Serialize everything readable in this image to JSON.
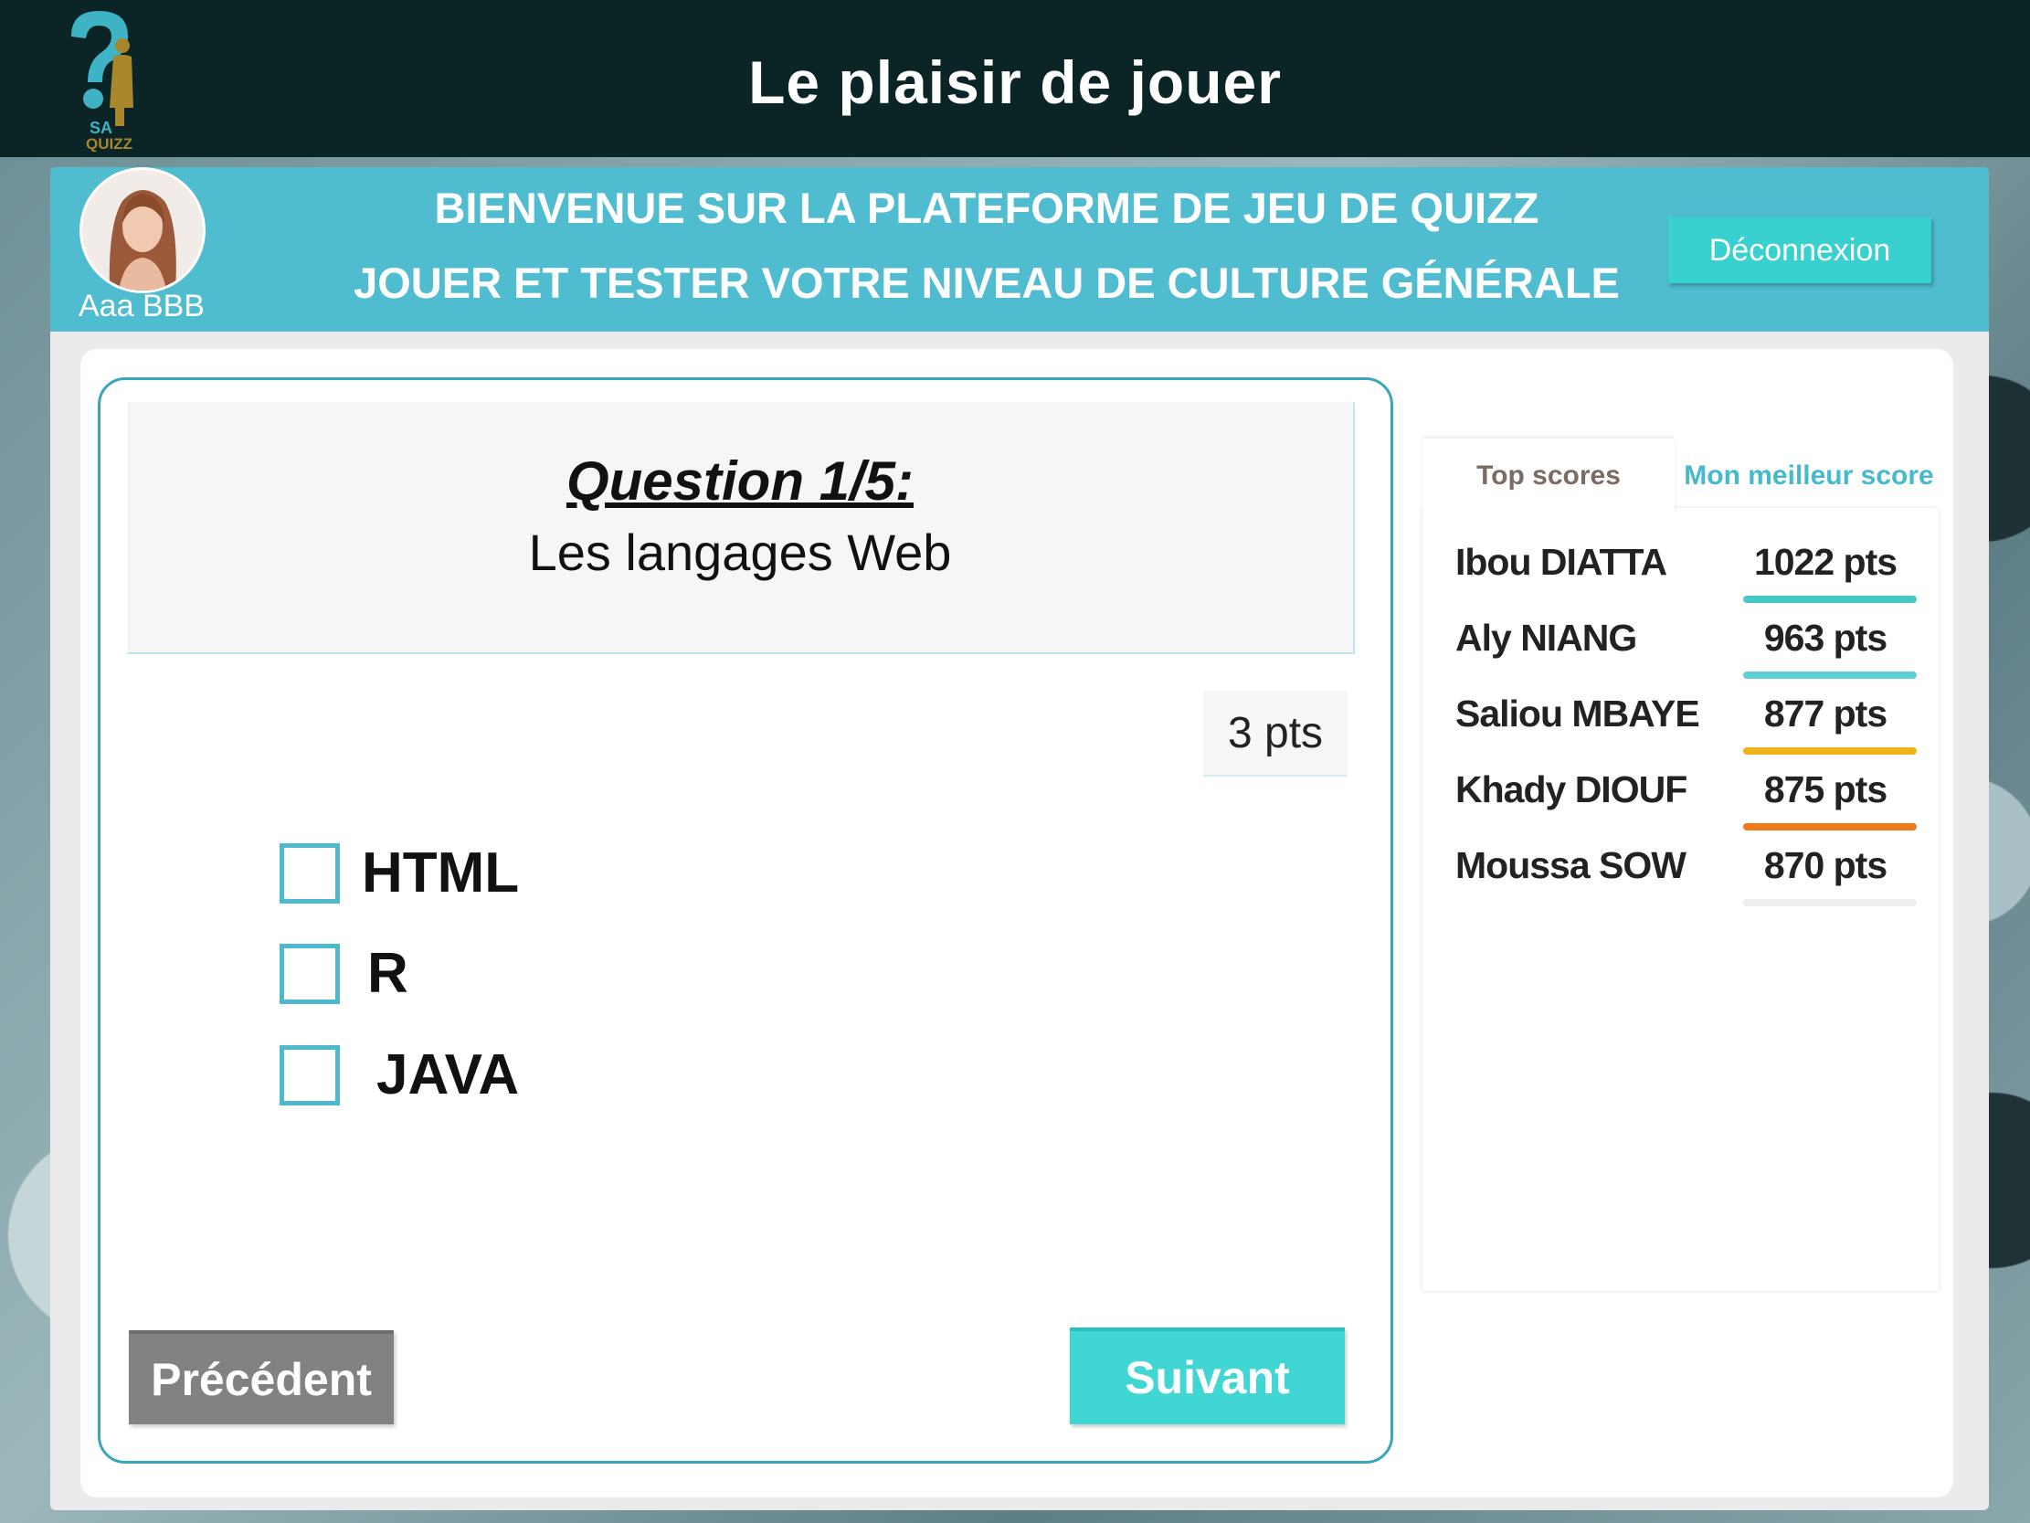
{
  "app": {
    "title": "Le plaisir de jouer",
    "logo_text_top": "SA",
    "logo_text_bottom": "QUIZZ"
  },
  "header": {
    "welcome_line1": "BIENVENUE SUR LA PLATEFORME DE JEU DE QUIZZ",
    "welcome_line2": "JOUER ET TESTER VOTRE NIVEAU DE CULTURE GÉNÉRALE",
    "username": "Aaa BBB",
    "logout_label": "Déconnexion"
  },
  "question": {
    "title": "Question 1/5:",
    "subtitle": "Les langages Web",
    "points": "3 pts",
    "options": [
      {
        "label": "HTML"
      },
      {
        "label": "R"
      },
      {
        "label": "JAVA"
      }
    ]
  },
  "nav": {
    "prev_label": "Précédent",
    "next_label": "Suivant"
  },
  "scores": {
    "tab_top": "Top scores",
    "tab_best": "Mon meilleur score",
    "rows": [
      {
        "name": "Ibou DIATTA",
        "score": "1022 pts",
        "color": "#45c9c3"
      },
      {
        "name": "Aly NIANG",
        "score": "963 pts",
        "color": "#5fd0d6"
      },
      {
        "name": "Saliou MBAYE",
        "score": "877 pts",
        "color": "#f0b21a"
      },
      {
        "name": "Khady DIOUF",
        "score": "875 pts",
        "color": "#ee7a19"
      },
      {
        "name": "Moussa SOW",
        "score": "870 pts",
        "color": "#eeeeee"
      }
    ]
  },
  "colors": {
    "topbar": "#0b2527",
    "header_band": "#4fbccf",
    "accent": "#38d1cf",
    "prev_button": "#828282"
  }
}
